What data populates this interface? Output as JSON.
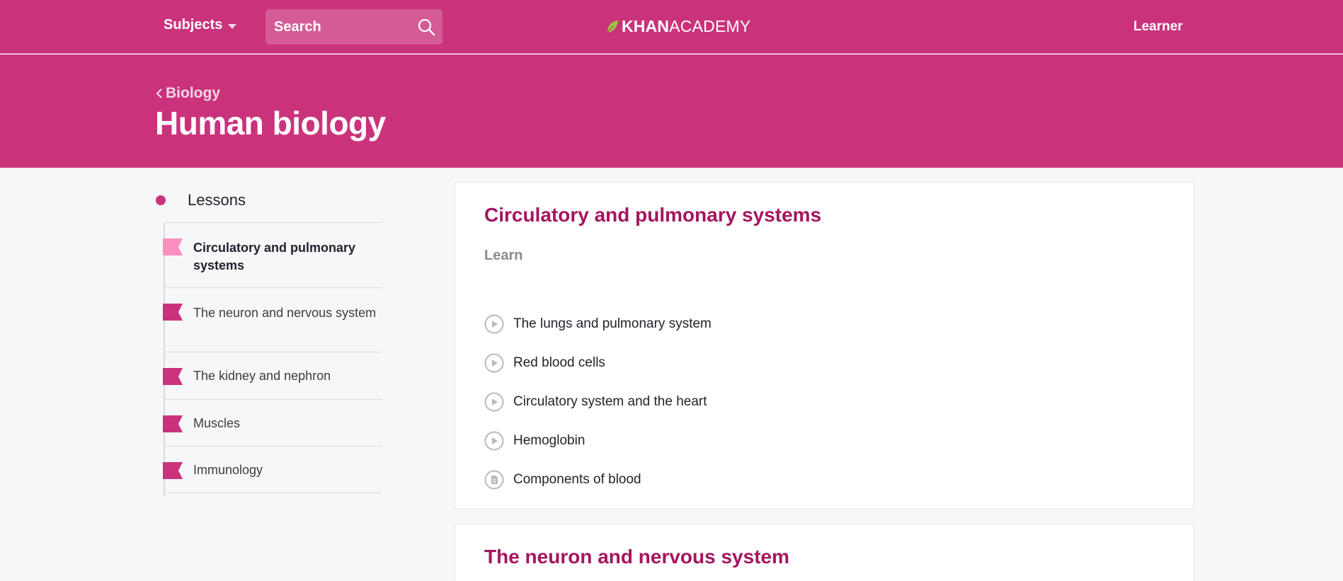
{
  "nav": {
    "subjects_label": "Subjects",
    "search_placeholder": "Search",
    "logo_bold": "KHAN",
    "logo_light": "ACADEMY",
    "learner_label": "Learner"
  },
  "header": {
    "breadcrumb": "Biology",
    "title": "Human biology"
  },
  "sidebar": {
    "heading": "Lessons",
    "items": [
      {
        "label": "Circulatory and pulmonary systems",
        "active": true
      },
      {
        "label": "The neuron and nervous system",
        "active": false
      },
      {
        "label": "The kidney and nephron",
        "active": false
      },
      {
        "label": "Muscles",
        "active": false
      },
      {
        "label": "Immunology",
        "active": false
      }
    ]
  },
  "cards": [
    {
      "title": "Circulatory and pulmonary systems",
      "section_label": "Learn",
      "items": [
        {
          "label": "The lungs and pulmonary system",
          "icon": "play-circle-icon"
        },
        {
          "label": "Red blood cells",
          "icon": "play-circle-icon"
        },
        {
          "label": "Circulatory system and the heart",
          "icon": "play-circle-icon"
        },
        {
          "label": "Hemoglobin",
          "icon": "play-circle-icon"
        },
        {
          "label": "Components of blood",
          "icon": "article-icon"
        }
      ]
    },
    {
      "title": "The neuron and nervous system"
    }
  ],
  "colors": {
    "brand": "#ca337c",
    "title": "#a5155e",
    "flag_active": "#ff8ec0",
    "flag": "#ca337c",
    "leaf": "#9cc63b"
  }
}
